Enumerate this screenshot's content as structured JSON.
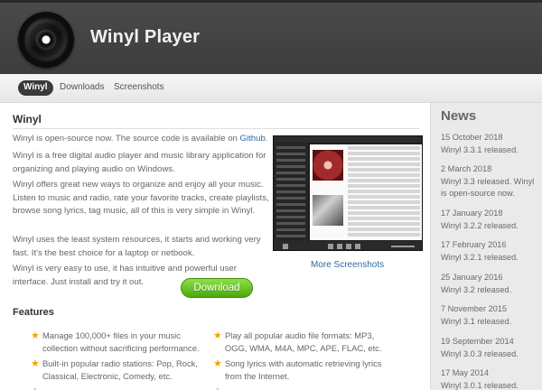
{
  "header": {
    "title": "Winyl Player",
    "logo_icon": "vinyl-record-icon"
  },
  "nav": {
    "items": [
      {
        "label": "Winyl",
        "active": true
      },
      {
        "label": "Downloads"
      },
      {
        "label": "Screenshots"
      }
    ]
  },
  "main": {
    "heading": "Winyl",
    "intro": {
      "text": "Winyl is open-source now. The source code is available on ",
      "link": "Github",
      "end": "."
    },
    "paragraphs": [
      "Winyl is a free digital audio player and music library application for organizing and playing audio on Windows.",
      "Winyl offers great new ways to organize and enjoy all your music. Listen to music and radio, rate your favorite tracks, create playlists, browse song lyrics, tag music, all of this is very simple in Winyl.",
      "Winyl uses the least system resources, it starts and working very fast. It's the best choice for a laptop or netbook.",
      "Winyl is very easy to use, it has intuitive and powerful user interface. Just install and try it out."
    ],
    "more_screenshots": "More Screenshots",
    "download_label": "Download",
    "features_heading": "Features",
    "features": [
      "Manage 100,000+ files in your music collection without sacrificing performance.",
      "Play all popular audio file formats: MP3, OGG, WMA, M4A, MPC, APE, FLAC, etc.",
      "Built-in popular radio stations: Pop, Rock, Classical, Electronic, Comedy, etc.",
      "Song lyrics with automatic retrieving lyrics from the Internet."
    ]
  },
  "news": {
    "heading": "News",
    "items": [
      {
        "date": "15 October 2018",
        "text": "Winyl 3.3.1 released."
      },
      {
        "date": "2 March 2018",
        "text": "Winyl 3.3 released. Winyl is open-source now."
      },
      {
        "date": "17 January 2018",
        "text": "Winyl 3.2.2 released."
      },
      {
        "date": "17 February 2016",
        "text": "Winyl 3.2.1 released."
      },
      {
        "date": "25 January 2016",
        "text": "Winyl 3.2 released."
      },
      {
        "date": "7 November 2015",
        "text": "Winyl 3.1 released."
      },
      {
        "date": "19 September 2014",
        "text": "Winyl 3.0.3 released."
      },
      {
        "date": "17 May 2014",
        "text": "Winyl 3.0.1 released."
      }
    ]
  },
  "colors": {
    "link": "#2e6ba3",
    "download_green": "#5cbf1a",
    "header_bg": "#444444",
    "star": "#f0a500"
  }
}
